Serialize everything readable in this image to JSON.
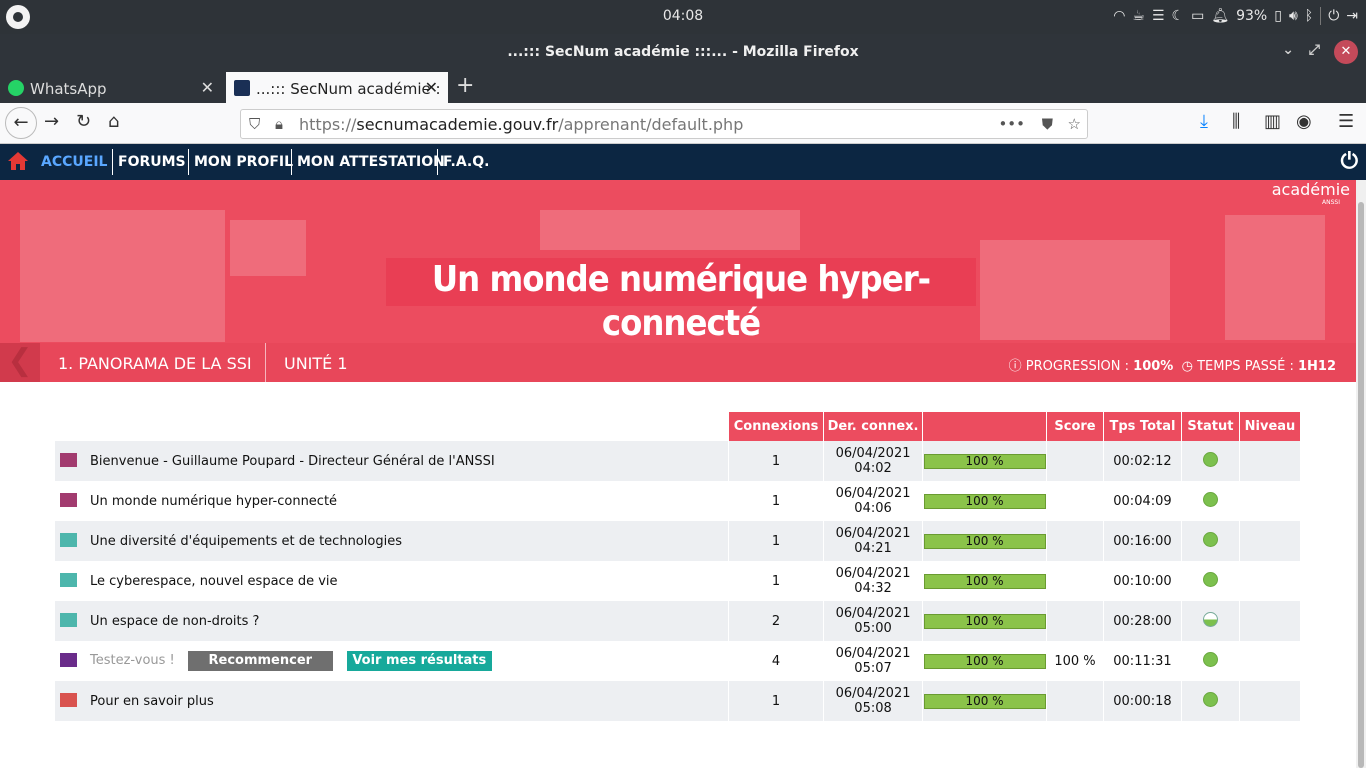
{
  "system": {
    "clock": "04:08",
    "battery": "93%"
  },
  "window": {
    "title": "...::: SecNum académie :::... - Mozilla Firefox"
  },
  "tabs": [
    {
      "label": "WhatsApp"
    },
    {
      "label": "...::: SecNum académie :"
    }
  ],
  "url": {
    "prefix": "https://",
    "host": "secnumacademie.gouv.fr",
    "path": "/apprenant/default.php"
  },
  "sitenav": {
    "items": [
      "ACCUEIL",
      "FORUMS",
      "MON PROFIL",
      "MON ATTESTATION",
      "F.A.Q."
    ]
  },
  "banner": {
    "title": "Un monde numérique hyper-connecté",
    "brand": "académie",
    "brand_sub": "ANSSI"
  },
  "breadcrumb": {
    "module": "1. PANORAMA DE LA SSI",
    "unit": "UNITÉ 1"
  },
  "progress": {
    "progress_label": "PROGRESSION :",
    "progress_value": "100%",
    "time_label": "TEMPS PASSÉ :",
    "time_value": "1H12"
  },
  "table": {
    "headers": [
      "Connexions",
      "Der. connex.",
      "",
      "Score",
      "Tps Total",
      "Statut",
      "Niveau"
    ],
    "rows": [
      {
        "name": "Bienvenue - Guillaume Poupard - Directeur Général de l'ANSSI",
        "type": "video-icon",
        "connexions": "1",
        "date": "06/04/2021",
        "time": "04:02",
        "progress": "100 %",
        "score": "",
        "total": "00:02:12",
        "status": "complete"
      },
      {
        "name": "Un monde numérique hyper-connecté",
        "type": "video-icon",
        "connexions": "1",
        "date": "06/04/2021",
        "time": "04:06",
        "progress": "100 %",
        "score": "",
        "total": "00:04:09",
        "status": "complete"
      },
      {
        "name": "Une diversité d'équipements et de technologies",
        "type": "book-icon",
        "connexions": "1",
        "date": "06/04/2021",
        "time": "04:21",
        "progress": "100 %",
        "score": "",
        "total": "00:16:00",
        "status": "complete"
      },
      {
        "name": "Le cyberespace, nouvel espace de vie",
        "type": "book-icon",
        "connexions": "1",
        "date": "06/04/2021",
        "time": "04:32",
        "progress": "100 %",
        "score": "",
        "total": "00:10:00",
        "status": "complete"
      },
      {
        "name": "Un espace de non-droits ?",
        "type": "book-icon",
        "connexions": "2",
        "date": "06/04/2021",
        "time": "05:00",
        "progress": "100 %",
        "score": "",
        "total": "00:28:00",
        "status": "half"
      },
      {
        "name": "Testez-vous !",
        "type": "quiz-icon",
        "connexions": "4",
        "date": "06/04/2021",
        "time": "05:07",
        "progress": "100 %",
        "score": "100 %",
        "total": "00:11:31",
        "status": "complete",
        "btn_restart": "Recommencer",
        "btn_results": "Voir mes résultats"
      },
      {
        "name": "Pour en savoir plus",
        "type": "document-icon",
        "connexions": "1",
        "date": "06/04/2021",
        "time": "05:08",
        "progress": "100 %",
        "score": "",
        "total": "00:00:18",
        "status": "complete"
      }
    ]
  },
  "colors": {
    "accent": "#ec4c5f",
    "nav": "#0c2642",
    "bar": "#8bc34a",
    "teal": "#17a99b"
  }
}
